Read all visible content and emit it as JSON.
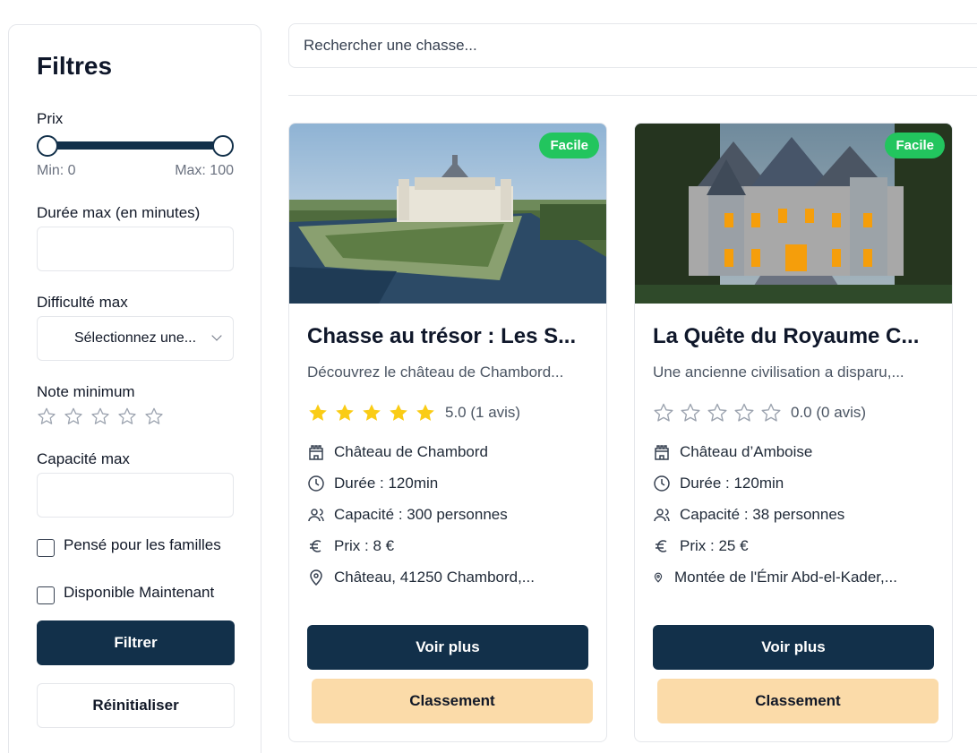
{
  "sidebar": {
    "title": "Filtres",
    "price_label": "Prix",
    "price_min_label": "Min: 0",
    "price_max_label": "Max: 100",
    "duration_label": "Durée max (en minutes)",
    "duration_value": "",
    "difficulty_label": "Difficulté max",
    "difficulty_selected": "Sélectionnez une...",
    "rating_label": "Note minimum",
    "capacity_label": "Capacité max",
    "capacity_value": "",
    "family_label": "Pensé pour les familles",
    "available_label": "Disponible Maintenant",
    "filter_button": "Filtrer",
    "reset_button": "Réinitialiser"
  },
  "search": {
    "placeholder": "Rechercher une chasse..."
  },
  "cards": [
    {
      "badge": "Facile",
      "title": "Chasse au trésor : Les S...",
      "description": "Découvrez le château de Chambord...",
      "rating_value": 5,
      "rating_text": "5.0 (1 avis)",
      "location": "Château de Chambord",
      "duration": "Durée : 120min",
      "capacity": "Capacité : 300 personnes",
      "price": "Prix : 8 €",
      "address": "Château, 41250 Chambord,...",
      "more_button": "Voir plus",
      "rank_button": "Classement"
    },
    {
      "badge": "Facile",
      "title": "La Quête du Royaume C...",
      "description": "Une ancienne civilisation a disparu,...",
      "rating_value": 0,
      "rating_text": "0.0 (0 avis)",
      "location": "Château d’Amboise",
      "duration": "Durée : 120min",
      "capacity": "Capacité : 38 personnes",
      "price": "Prix : 25 €",
      "address": "Montée de l'Émir Abd-el-Kader,...",
      "more_button": "Voir plus",
      "rank_button": "Classement"
    }
  ],
  "colors": {
    "primary": "#12304a",
    "secondary": "#fbdba9",
    "badge": "#22c55e",
    "star": "#facc15"
  }
}
